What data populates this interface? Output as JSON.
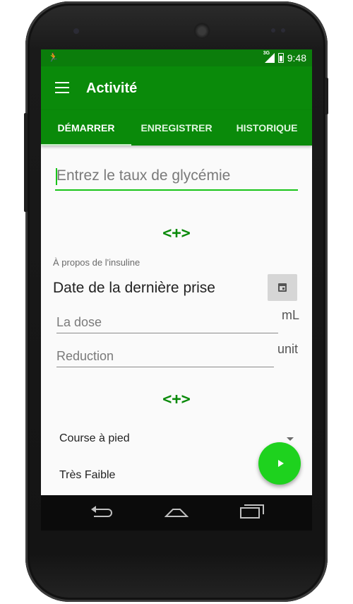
{
  "status_bar": {
    "left_icon": "running-person-icon",
    "network": "3G",
    "time": "9:48"
  },
  "app_bar": {
    "title": "Activité"
  },
  "tabs": [
    {
      "label": "DÉMARRER",
      "active": true
    },
    {
      "label": "ENREGISTRER",
      "active": false
    },
    {
      "label": "HISTORIQUE",
      "active": false
    }
  ],
  "glycemia": {
    "placeholder": "Entrez le taux de glycémie",
    "value": ""
  },
  "add_button_label": "<+>",
  "insulin": {
    "section_label": "À propos de l'insuline",
    "date_label": "Date de la dernière prise",
    "dose_placeholder": "La dose",
    "dose_unit": "mL",
    "reduction_placeholder": "Reduction",
    "reduction_unit": "unit"
  },
  "activity": {
    "add_button_label": "<+>",
    "type_selected": "Course à pied",
    "intensity": "Très Faible"
  },
  "colors": {
    "primary": "#0a8a0a",
    "status_bar": "#0b7d0b",
    "accent": "#1ed21e"
  }
}
